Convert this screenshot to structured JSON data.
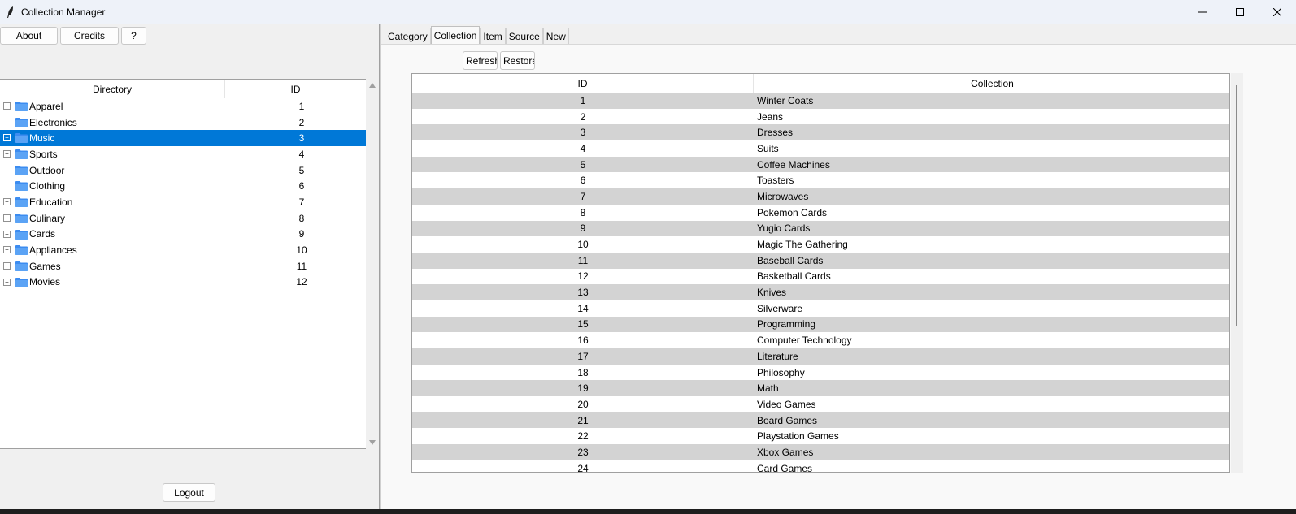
{
  "window": {
    "title": "Collection Manager"
  },
  "left": {
    "buttons": {
      "about": "About",
      "credits": "Credits",
      "help": "?"
    },
    "tree": {
      "columns": {
        "directory": "Directory",
        "id": "ID"
      },
      "rows": [
        {
          "label": "Apparel",
          "id": "1",
          "expandable": true
        },
        {
          "label": "Electronics",
          "id": "2",
          "expandable": false
        },
        {
          "label": "Music",
          "id": "3",
          "expandable": true,
          "selected": true
        },
        {
          "label": "Sports",
          "id": "4",
          "expandable": true
        },
        {
          "label": "Outdoor",
          "id": "5",
          "expandable": false
        },
        {
          "label": "Clothing",
          "id": "6",
          "expandable": false
        },
        {
          "label": "Education",
          "id": "7",
          "expandable": true
        },
        {
          "label": "Culinary",
          "id": "8",
          "expandable": true
        },
        {
          "label": "Cards",
          "id": "9",
          "expandable": true
        },
        {
          "label": "Appliances",
          "id": "10",
          "expandable": true
        },
        {
          "label": "Games",
          "id": "11",
          "expandable": true
        },
        {
          "label": "Movies",
          "id": "12",
          "expandable": true
        }
      ]
    },
    "logout": "Logout"
  },
  "right": {
    "tabs": [
      "Category",
      "Collection",
      "Item",
      "Source",
      "New"
    ],
    "active_tab": "Collection",
    "buttons": {
      "refresh": "Refresh",
      "restore": "Restore"
    },
    "table": {
      "columns": {
        "id": "ID",
        "collection": "Collection"
      },
      "rows": [
        {
          "id": "1",
          "name": "Winter Coats"
        },
        {
          "id": "2",
          "name": "Jeans"
        },
        {
          "id": "3",
          "name": "Dresses"
        },
        {
          "id": "4",
          "name": "Suits"
        },
        {
          "id": "5",
          "name": "Coffee Machines"
        },
        {
          "id": "6",
          "name": "Toasters"
        },
        {
          "id": "7",
          "name": "Microwaves"
        },
        {
          "id": "8",
          "name": "Pokemon Cards"
        },
        {
          "id": "9",
          "name": "Yugio Cards"
        },
        {
          "id": "10",
          "name": "Magic The Gathering"
        },
        {
          "id": "11",
          "name": "Baseball Cards"
        },
        {
          "id": "12",
          "name": "Basketball Cards"
        },
        {
          "id": "13",
          "name": "Knives"
        },
        {
          "id": "14",
          "name": "Silverware"
        },
        {
          "id": "15",
          "name": "Programming"
        },
        {
          "id": "16",
          "name": "Computer Technology"
        },
        {
          "id": "17",
          "name": "Literature"
        },
        {
          "id": "18",
          "name": "Philosophy"
        },
        {
          "id": "19",
          "name": "Math"
        },
        {
          "id": "20",
          "name": "Video Games"
        },
        {
          "id": "21",
          "name": "Board Games"
        },
        {
          "id": "22",
          "name": "Playstation Games"
        },
        {
          "id": "23",
          "name": "Xbox Games"
        },
        {
          "id": "24",
          "name": "Card Games"
        }
      ]
    }
  },
  "colors": {
    "selection": "#0078d7",
    "stripe": "#d3d3d3",
    "folder": "#3c8cf0"
  }
}
